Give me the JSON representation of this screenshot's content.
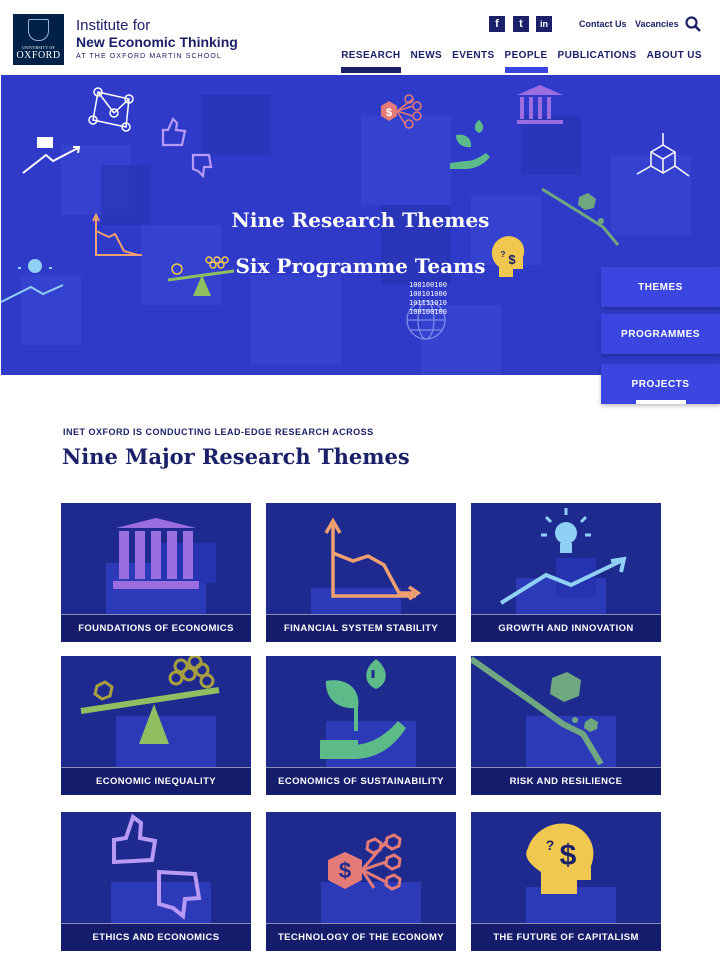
{
  "header": {
    "logo": {
      "university": "UNIVERSITY OF",
      "name": "OXFORD"
    },
    "org_line1": "Institute for",
    "org_line2": "New Economic Thinking",
    "org_line3": "AT THE OXFORD MARTIN SCHOOL",
    "social": [
      {
        "icon": "facebook-icon",
        "glyph": "f"
      },
      {
        "icon": "twitter-icon",
        "glyph": "t"
      },
      {
        "icon": "linkedin-icon",
        "glyph": "in"
      }
    ],
    "top_links": [
      "Contact Us",
      "Vacancies"
    ],
    "nav": [
      {
        "label": "RESEARCH",
        "active_color": "#1b2169"
      },
      {
        "label": "NEWS"
      },
      {
        "label": "EVENTS"
      },
      {
        "label": "PEOPLE",
        "active_color": "#3b46e0"
      },
      {
        "label": "PUBLICATIONS"
      },
      {
        "label": "ABOUT US"
      }
    ]
  },
  "hero": {
    "line1": "Nine Research Themes",
    "line2": "Six Programme Teams",
    "binary": [
      "100100100",
      "100101000",
      "101111010",
      "100100100"
    ],
    "side_buttons": [
      "THEMES",
      "PROGRAMMES",
      "PROJECTS"
    ]
  },
  "section": {
    "kicker": "INET OXFORD IS CONDUCTING LEAD-EDGE RESEARCH ACROSS",
    "title": "Nine Major Research Themes"
  },
  "themes": [
    {
      "label": "FOUNDATIONS OF ECONOMICS",
      "icon": "institution-icon"
    },
    {
      "label": "FINANCIAL SYSTEM STABILITY",
      "icon": "falling-chart-icon"
    },
    {
      "label": "GROWTH AND INNOVATION",
      "icon": "lightbulb-growth-icon"
    },
    {
      "label": "ECONOMIC INEQUALITY",
      "icon": "balance-scale-icon"
    },
    {
      "label": "ECONOMICS OF SUSTAINABILITY",
      "icon": "plant-hand-icon"
    },
    {
      "label": "RISK AND RESILIENCE",
      "icon": "risk-line-icon"
    },
    {
      "label": "ETHICS AND ECONOMICS",
      "icon": "thumbs-icon"
    },
    {
      "label": "TECHNOLOGY OF THE ECONOMY",
      "icon": "network-dollar-icon"
    },
    {
      "label": "THE FUTURE OF CAPITALISM",
      "icon": "head-dollar-icon"
    }
  ],
  "colors": {
    "brand": "#1b2169",
    "hero": "#2f3bc8",
    "accent": "#3b46e0",
    "card": "#1f2a8f",
    "orange": "#f0a070",
    "purple": "#9b6ee0",
    "green": "#5dbb8a",
    "yellow": "#f0c850"
  }
}
